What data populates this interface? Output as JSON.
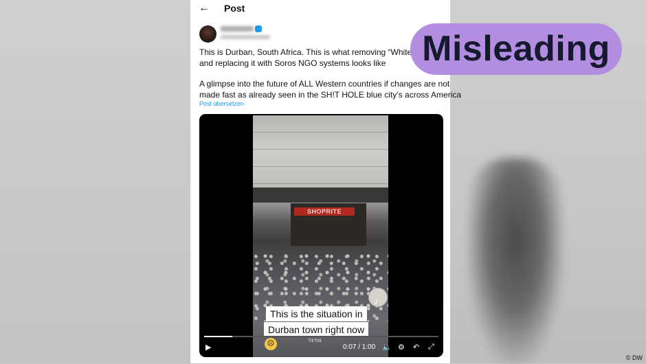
{
  "post": {
    "header_title": "Post",
    "text_line1": "This is Durban, South Africa. This is what removing “White Opp",
    "text_line2": "and replacing it with Soros NGO systems looks like",
    "text_line3": "A glimpse into the future of ALL Western countries if changes are not",
    "text_line4": "made fast as already seen in the SH!T HOLE blue city’s across America",
    "translate_link": "Post übersetzen"
  },
  "video": {
    "caption_line1": "This is the situation in",
    "caption_line2": "Durban town right now",
    "store_sign": "SHOPRITE",
    "watermark": "TikTok",
    "time": "0:07 / 1:00",
    "progress": 0.12,
    "icons": [
      "play-icon",
      "volume-icon",
      "settings-gear-icon",
      "rotate-icon",
      "fullscreen-icon"
    ]
  },
  "overlay": {
    "label": "Misleading",
    "color": "#b38ee0"
  },
  "credit": "© DW",
  "colors": {
    "link": "#1d9bf0",
    "text": "#0f1419"
  }
}
